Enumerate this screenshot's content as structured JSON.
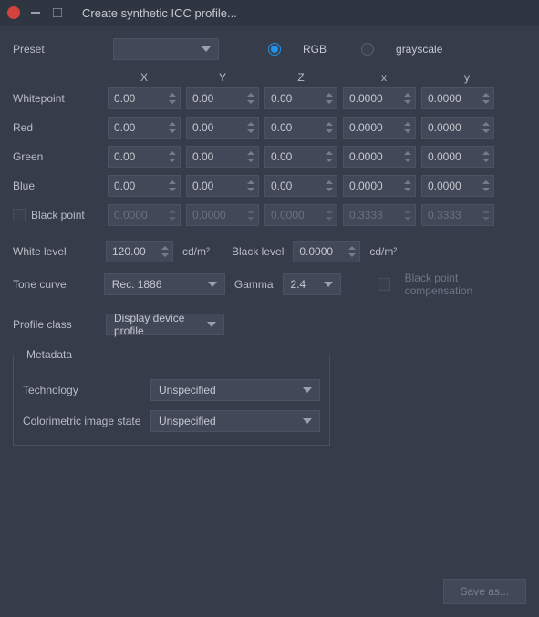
{
  "titlebar": {
    "title": "Create synthetic ICC profile..."
  },
  "preset": {
    "label": "Preset"
  },
  "colormode": {
    "rgb": "RGB",
    "grayscale": "grayscale"
  },
  "headers": {
    "X": "X",
    "Y": "Y",
    "Z": "Z",
    "x": "x",
    "y": "y"
  },
  "rows": {
    "whitepoint": {
      "label": "Whitepoint",
      "X": "0.00",
      "Y": "0.00",
      "Z": "0.00",
      "x": "0.0000",
      "y": "0.0000"
    },
    "red": {
      "label": "Red",
      "X": "0.00",
      "Y": "0.00",
      "Z": "0.00",
      "x": "0.0000",
      "y": "0.0000"
    },
    "green": {
      "label": "Green",
      "X": "0.00",
      "Y": "0.00",
      "Z": "0.00",
      "x": "0.0000",
      "y": "0.0000"
    },
    "blue": {
      "label": "Blue",
      "X": "0.00",
      "Y": "0.00",
      "Z": "0.00",
      "x": "0.0000",
      "y": "0.0000"
    },
    "blackpoint": {
      "label": "Black point",
      "X": "0.0000",
      "Y": "0.0000",
      "Z": "0.0000",
      "x": "0.3333",
      "y": "0.3333"
    }
  },
  "levels": {
    "white_label": "White level",
    "white_value": "120.00",
    "white_units": "cd/m²",
    "black_label": "Black level",
    "black_value": "0.0000",
    "black_units": "cd/m²"
  },
  "tonecurve": {
    "label": "Tone curve",
    "value": "Rec. 1886",
    "gamma_label": "Gamma",
    "gamma_value": "2.4",
    "bpc_label": "Black point compensation"
  },
  "profileclass": {
    "label": "Profile class",
    "value": "Display device profile"
  },
  "metadata": {
    "legend": "Metadata",
    "technology_label": "Technology",
    "technology_value": "Unspecified",
    "cis_label": "Colorimetric image state",
    "cis_value": "Unspecified"
  },
  "buttons": {
    "save": "Save as..."
  }
}
